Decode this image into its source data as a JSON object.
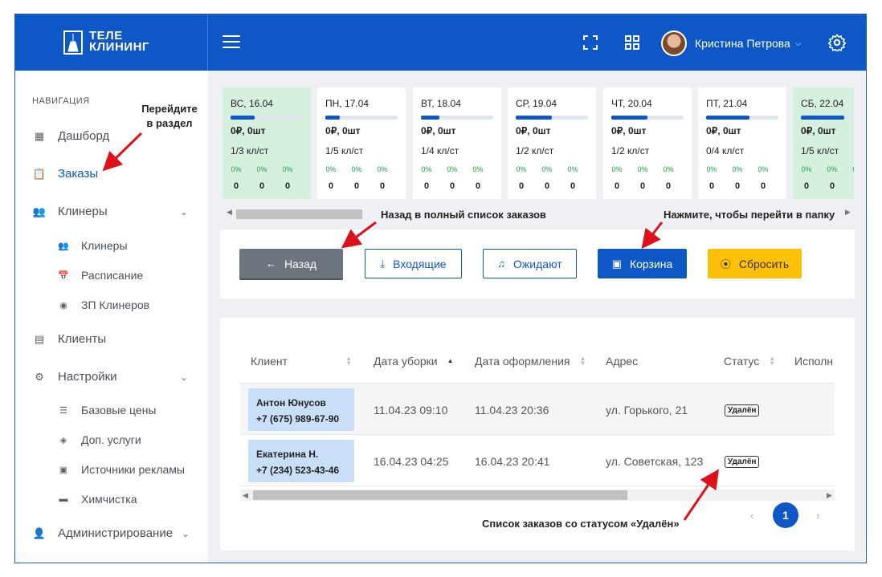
{
  "brand": {
    "line1": "ТЕЛЕ",
    "line2": "КЛИНИНГ"
  },
  "header": {
    "user_name": "Кристина Петрова",
    "icons": [
      "menu-icon",
      "fullscreen-icon",
      "apps-grid-icon",
      "settings-icon"
    ]
  },
  "sidebar": {
    "heading": "НАВИГАЦИЯ",
    "items": {
      "dashboard": "Дашборд",
      "orders": "Заказы",
      "cleaners": "Клинеры",
      "cleaners_sub": "Клинеры",
      "schedule": "Расписание",
      "salary": "ЗП Клинеров",
      "clients": "Клиенты",
      "settings": "Настройки",
      "base_prices": "Базовые цены",
      "extra_services": "Доп. услуги",
      "ad_sources": "Источники рекламы",
      "dry_cleaning": "Химчистка",
      "admin": "Администрирование"
    }
  },
  "week": [
    {
      "day": "ВС, 16.04",
      "sum": "0₽,",
      "qty": "0шт",
      "kl": "1/3 кл/ст",
      "pct": [
        "0%",
        "0%",
        "0%"
      ],
      "cnt": [
        "0",
        "0",
        "0"
      ],
      "fill": 0.33,
      "green": true
    },
    {
      "day": "ПН, 17.04",
      "sum": "0₽,",
      "qty": "0шт",
      "kl": "1/5 кл/ст",
      "pct": [
        "0%",
        "0%",
        "0%"
      ],
      "cnt": [
        "0",
        "0",
        "0"
      ],
      "fill": 0.2,
      "green": false
    },
    {
      "day": "ВТ, 18.04",
      "sum": "0₽,",
      "qty": "0шт",
      "kl": "1/4 кл/ст",
      "pct": [
        "0%",
        "0%",
        "0%"
      ],
      "cnt": [
        "0",
        "0",
        "0"
      ],
      "fill": 0.25,
      "green": false
    },
    {
      "day": "СР, 19.04",
      "sum": "0₽,",
      "qty": "0шт",
      "kl": "1/2 кл/ст",
      "pct": [
        "0%",
        "0%",
        "0%"
      ],
      "cnt": [
        "0",
        "0",
        "0"
      ],
      "fill": 0.5,
      "green": false
    },
    {
      "day": "ЧТ, 20.04",
      "sum": "0₽,",
      "qty": "0шт",
      "kl": "1/2 кл/ст",
      "pct": [
        "0%",
        "0%",
        "0%"
      ],
      "cnt": [
        "0",
        "0",
        "0"
      ],
      "fill": 0.5,
      "green": false
    },
    {
      "day": "ПТ, 21.04",
      "sum": "0₽,",
      "qty": "0шт",
      "kl": "0/4 кл/ст",
      "pct": [
        "0%",
        "0%",
        "0%"
      ],
      "cnt": [
        "0",
        "0",
        "0"
      ],
      "fill": 0.6,
      "green": false
    },
    {
      "day": "СБ, 22.04",
      "sum": "0₽,",
      "qty": "0шт",
      "kl": "1/5 кл/ст",
      "pct": [
        "0%",
        "0%",
        "0%"
      ],
      "cnt": [
        "0",
        "0",
        "0"
      ],
      "fill": 0.6,
      "green": true
    }
  ],
  "filters": {
    "back": "Назад",
    "incoming": "Входящие",
    "waiting": "Ожидают",
    "trash": "Корзина",
    "reset": "Сбросить"
  },
  "table": {
    "columns": [
      "Клиент",
      "Дата уборки",
      "Дата оформления",
      "Адрес",
      "Статус",
      "Исполн"
    ],
    "rows": [
      {
        "name": "Антон Юнусов",
        "phone": "+7 (675) 989-67-90",
        "clean_date": "11.04.23 09:10",
        "order_date": "11.04.23 20:36",
        "address": "ул. Горького, 21",
        "status": "Удалён"
      },
      {
        "name": "Екатерина Н.",
        "phone": "+7 (234) 523-43-46",
        "clean_date": "16.04.23 04:25",
        "order_date": "16.04.23 20:41",
        "address": "ул. Советская, 123",
        "status": "Удалён"
      }
    ],
    "page": "1"
  },
  "annotations": {
    "goto_section": "Перейдите в раздел",
    "back_hint": "Назад в полный список заказов",
    "folder_hint": "Нажмите, чтобы перейти в папку",
    "list_hint": "Список заказов со статусом «Удалён»"
  },
  "colors": {
    "brand_blue": "#0d57c6",
    "annotation_red": "#e0101a",
    "warning": "#ffc107",
    "success_bg": "#d6f0de"
  }
}
